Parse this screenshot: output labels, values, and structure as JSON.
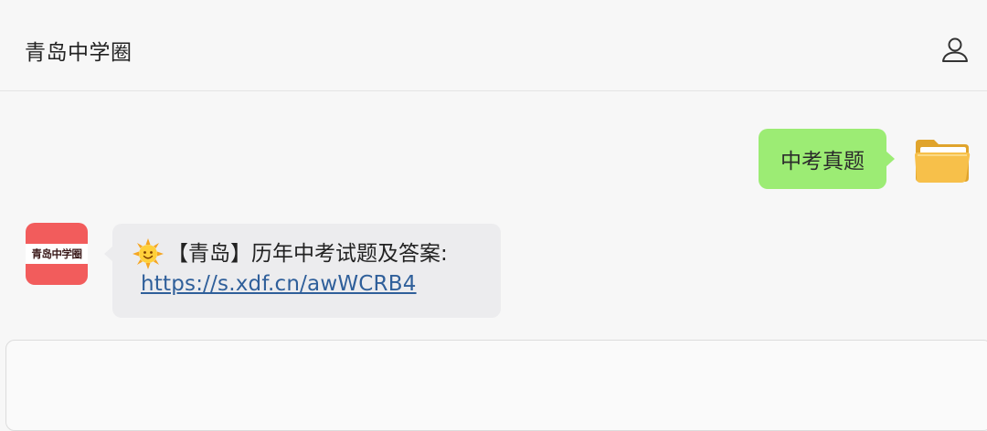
{
  "header": {
    "title": "青岛中学圈",
    "profile_icon": "user-profile-icon"
  },
  "messages": {
    "outgoing": {
      "text": "中考真题",
      "bubble_color": "#95ec69",
      "avatar_icon": "folder-icon"
    },
    "incoming": {
      "avatar_text": "青岛中学圈",
      "avatar_color": "#f25c5c",
      "emoji_icon": "sun-icon",
      "text": "【青岛】历年中考试题及答案:",
      "link": "https://s.xdf.cn/awWCRB4",
      "link_color": "#2f5f9a"
    }
  },
  "composer": {
    "value": ""
  }
}
